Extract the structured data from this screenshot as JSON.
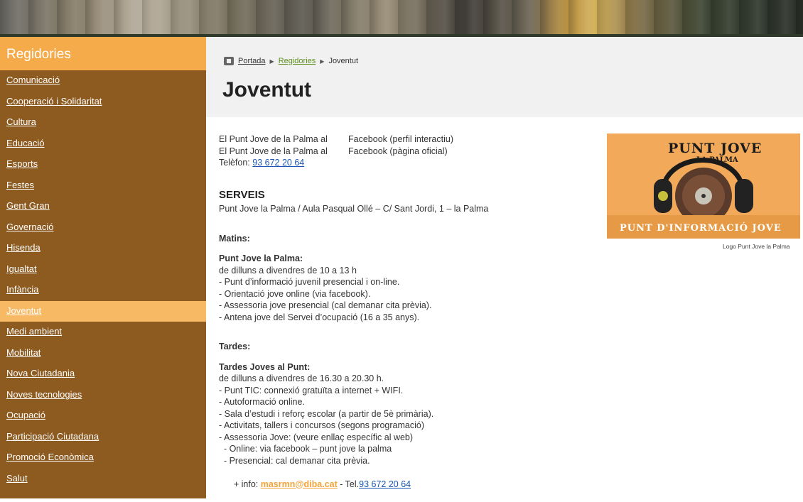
{
  "sidebar": {
    "title": "Regidories",
    "items": [
      {
        "label": "Comunicació"
      },
      {
        "label": "Cooperació i Solidaritat"
      },
      {
        "label": "Cultura"
      },
      {
        "label": "Educació"
      },
      {
        "label": "Esports"
      },
      {
        "label": "Festes"
      },
      {
        "label": "Gent Gran"
      },
      {
        "label": "Governació"
      },
      {
        "label": "Hisenda"
      },
      {
        "label": "Igualtat"
      },
      {
        "label": "Infància"
      },
      {
        "label": "Joventut"
      },
      {
        "label": "Medi ambient"
      },
      {
        "label": "Mobilitat"
      },
      {
        "label": "Nova Ciutadania"
      },
      {
        "label": "Noves tecnologies"
      },
      {
        "label": "Ocupació"
      },
      {
        "label": "Participació Ciutadana"
      },
      {
        "label": "Promoció Econòmica"
      },
      {
        "label": "Salut"
      }
    ],
    "active_index": 11
  },
  "breadcrumb": {
    "home": "Portada",
    "section": "Regidories",
    "current": "Joventut"
  },
  "page_title": "Joventut",
  "contact": {
    "fb1_prefix": "El Punt Jove de la Palma al",
    "fb1_link": "Facebook (perfil interactiu)",
    "fb2_prefix": "El Punt Jove de la Palma al",
    "fb2_link": "Facebook (pàgina oficial)",
    "phone_label": "Telèfon: ",
    "phone": "93 672 20 64"
  },
  "serveis": {
    "heading": "SERVEIS",
    "address": "Punt Jove la Palma / Aula Pasqual Ollé – C/ Sant Jordi, 1 – la Palma",
    "mornings_heading": "Matins:",
    "mornings_title": "Punt Jove la Palma:",
    "mornings_hours": "de dilluns a divendres de 10 a 13 h",
    "mornings_items": [
      "- Punt d’informació juvenil presencial i on-line.",
      "- Orientació jove online (via facebook).",
      "- Assessoria jove presencial (cal demanar cita prèvia).",
      "- Antena jove del Servei d’ocupació (16 a 35 anys)."
    ],
    "afternoons_heading": "Tardes:",
    "afternoons_title": "Tardes Joves al Punt:",
    "afternoons_hours": "de dilluns a divendres de 16.30 a 20.30 h.",
    "afternoons_items": [
      "- Punt TIC: connexió gratuïta a internet + WIFI.",
      "- Autoformació online.",
      "- Sala d’estudi i reforç escolar (a partir de 5è primària).",
      "- Activitats, tallers i concursos (segons programació)",
      "- Assessoria Jove: (veure enllaç específic al web)",
      "  - Online: via facebook – punt jove la palma",
      "  - Presencial: cal demanar cita prèvia."
    ],
    "info_prefix": "  + info: ",
    "info_email": "masrmn@diba.cat",
    "info_tel_label": " - Tel.",
    "info_tel": "93 672 20 64"
  },
  "logo": {
    "title": "PUNT JOVE",
    "subtitle": "LA PALMA",
    "band": "PUNT D'INFORMACIÓ JOVE",
    "caption": "Logo Punt Jove la Palma"
  },
  "colors": {
    "sidebar_bg": "#8d5a1f",
    "sidebar_title_bg": "#f6ab4a",
    "active_item_bg": "#f7b964",
    "link_blue": "#1a57b4",
    "breadcrumb_green": "#5f8f1e",
    "email_orange": "#f2a33a"
  }
}
